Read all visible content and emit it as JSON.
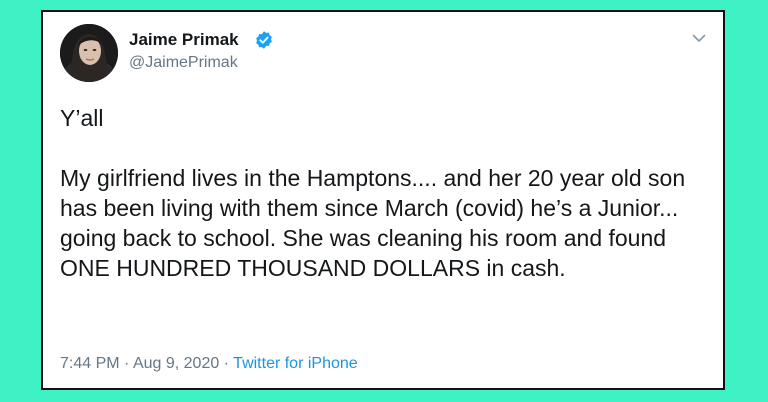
{
  "colors": {
    "background": "#3ff2c5",
    "card": "#ffffff",
    "border": "#111111",
    "text": "#14171a",
    "muted": "#657786",
    "link": "#1b95e0",
    "verified": "#1da1f2"
  },
  "author": {
    "display_name": "Jaime Primak",
    "handle": "@JaimePrimak",
    "verified": true,
    "verified_icon": "verified-badge-icon"
  },
  "menu_icon": "chevron-down-icon",
  "tweet": {
    "paragraphs": [
      "Y’all",
      "My girlfriend lives in the Hamptons.... and her 20 year old son has been living with them since March (covid) he’s a Junior... going back to school. She was cleaning his room and found ONE HUNDRED THOUSAND DOLLARS in cash."
    ]
  },
  "meta": {
    "time": "7:44 PM",
    "date": "Aug 9, 2020",
    "separator": " · ",
    "source": "Twitter for iPhone"
  }
}
